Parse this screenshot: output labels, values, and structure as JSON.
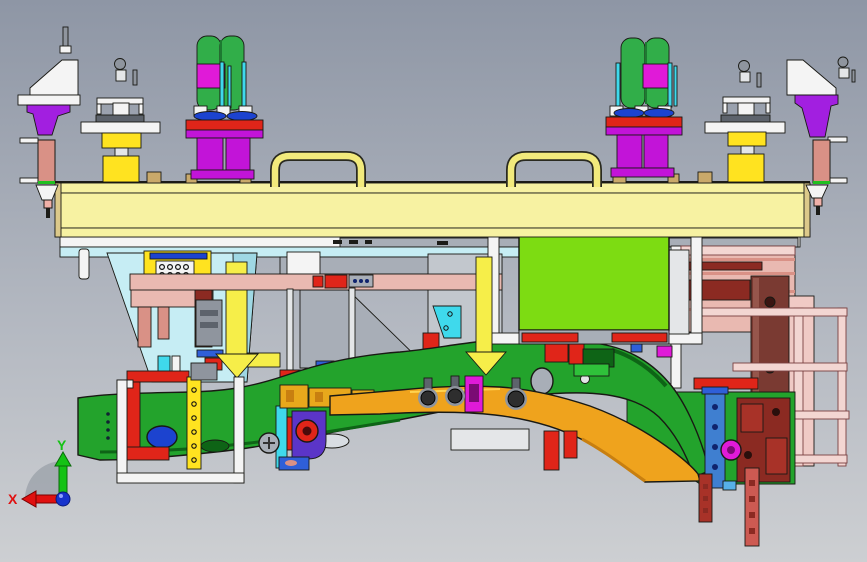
{
  "viewport": {
    "kind": "cad-3d-viewport",
    "axis_triad": {
      "x_label": "X",
      "y_label": "Y"
    },
    "palette": {
      "bg_top": "#8e96a5",
      "bg_mid": "#b2b7c0",
      "bg_bot": "#cdcfd2",
      "outline": "#191914",
      "beam": "#f7f2a2",
      "beam_end": "#dcc98a",
      "handle": "#f2ea7c",
      "white": "#f4f4f4",
      "offwhite": "#e4e6e8",
      "gray": "#a8aeb7",
      "gray_mid": "#8f959e",
      "gray_dark": "#5d636c",
      "gray_light": "#c2c7cd",
      "cyan_plate": "#c6edf4",
      "cyan_deep": "#9fd8e4",
      "cyan_bright": "#3fd9ec",
      "blue": "#2f5fd8",
      "blue_disc": "#1c43cf",
      "blue_med": "#3f7fd0",
      "navy": "#10246e",
      "sky": "#57b0e8",
      "red": "#e02519",
      "red_dark": "#8b2a22",
      "red_mid": "#a83228",
      "maroon": "#7a3a32",
      "maroon_light": "#96564c",
      "strip_red": "#cd5a52",
      "salmon": "#e9b9b1",
      "salmon_deep": "#d99186",
      "pink_light": "#f3d6d2",
      "pink_plate": "#f0cac5",
      "magenta": "#e01ad8",
      "magenta_dark": "#7a0b74",
      "violet_col": "#c214d8",
      "purple": "#a21fe0",
      "violet": "#5b35c8",
      "green_clamp": "#31ae49",
      "green_clamp_dark": "#1d7a31",
      "green_panel": "#7ddc12",
      "green_part": "#23a32c",
      "green_part_dark": "#0e6416",
      "green_bright": "#2fc13a",
      "orange": "#efa31d",
      "orange_dark": "#c87f10",
      "amber": "#e8a81c",
      "yellow": "#ffe320",
      "yellow_arrow": "#f6ee49",
      "tan": "#c9a96a",
      "axis_red": "#e01010",
      "axis_green": "#14c214",
      "axis_blue": "#1733cc",
      "axis_fan": "#9aa0a8"
    },
    "parts": [
      "main-beam",
      "lift-handle-left",
      "lift-handle-right",
      "toggle-clamp-left",
      "toggle-clamp-right",
      "rest-pedestal-left",
      "rest-pedestal-right",
      "corner-bracket-left",
      "corner-bracket-right",
      "support-tower-left",
      "support-tower-right",
      "pointer-arrow-left",
      "pointer-arrow-center",
      "guard-panel",
      "guard-panel-frame",
      "workpiece-upper-rail",
      "workpiece-lower-rail",
      "clamp-units",
      "base-frame",
      "axis-triad"
    ]
  }
}
